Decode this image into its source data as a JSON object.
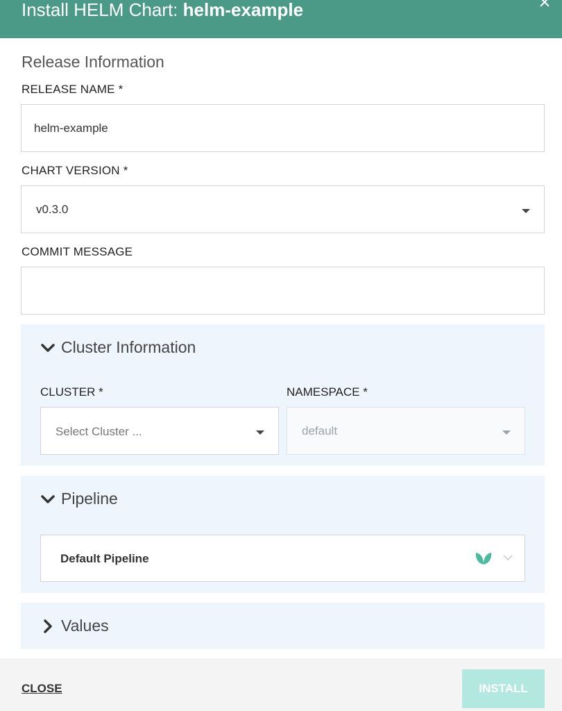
{
  "header": {
    "title_prefix": "Install HELM Chart: ",
    "chart_name": "helm-example"
  },
  "release": {
    "section_title": "Release Information",
    "release_name_label": "RELEASE NAME *",
    "release_name_value": "helm-example",
    "chart_version_label": "CHART VERSION *",
    "chart_version_value": "v0.3.0",
    "commit_message_label": "COMMIT MESSAGE",
    "commit_message_value": ""
  },
  "cluster_info": {
    "title": "Cluster Information",
    "cluster_label": "CLUSTER *",
    "cluster_placeholder": "Select Cluster ...",
    "namespace_label": "NAMESPACE *",
    "namespace_value": "default"
  },
  "pipeline": {
    "title": "Pipeline",
    "selected": "Default Pipeline"
  },
  "values": {
    "title": "Values"
  },
  "footer": {
    "close_label": "CLOSE",
    "install_label": "INSTALL"
  },
  "colors": {
    "header_bg": "#4a9a87",
    "panel_bg": "#eef5fd",
    "install_btn_bg": "#b3e8e0",
    "leaf_icon": "#4fb9a0"
  }
}
